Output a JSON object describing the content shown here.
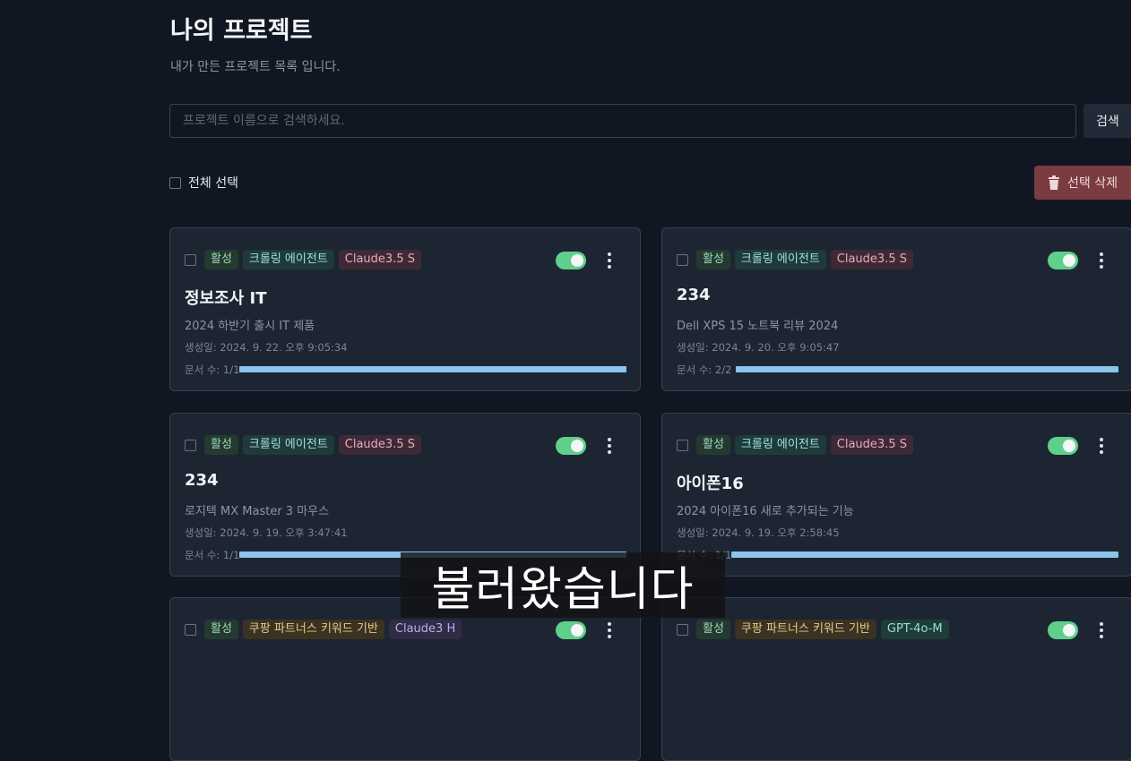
{
  "header": {
    "title": "나의 프로젝트",
    "subtitle": "내가 만든 프로젝트 목록 입니다."
  },
  "search": {
    "placeholder": "프로젝트 이름으로 검색하세요.",
    "button_label": "검색"
  },
  "toolbar": {
    "select_all_label": "전체 선택",
    "delete_label": "선택 삭제",
    "delete_icon": "trash-icon"
  },
  "colors": {
    "background": "#111722",
    "card": "#1d2532",
    "toggle_on": "#5fd08c",
    "progress": "#8bc4ec",
    "delete": "#7a3c40"
  },
  "projects": [
    {
      "status": "활성",
      "type": "크롤링 에이전트",
      "model": "Claude3.5 S",
      "title": "정보조사 IT",
      "description": "2024 하반기 출시 IT 제품",
      "created": "생성일: 2024. 9. 22. 오후 9:05:34",
      "doc_count": "문서 수: 1/1",
      "progress": 1.0,
      "enabled": true
    },
    {
      "status": "활성",
      "type": "크롤링 에이전트",
      "model": "Claude3.5 S",
      "title": "234",
      "description": "Dell XPS 15 노트북 리뷰 2024",
      "created": "생성일: 2024. 9. 20. 오후 9:05:47",
      "doc_count": "문서 수: 2/2",
      "progress": 1.0,
      "enabled": true
    },
    {
      "status": "활성",
      "type": "크롤링 에이전트",
      "model": "Claude3.5 S",
      "title": "234",
      "description": "로지텍 MX Master 3 마우스",
      "created": "생성일: 2024. 9. 19. 오후 3:47:41",
      "doc_count": "문서 수: 1/1",
      "progress": 1.0,
      "enabled": true
    },
    {
      "status": "활성",
      "type": "크롤링 에이전트",
      "model": "Claude3.5 S",
      "title": "아이폰16",
      "description": "2024 아이폰16 새로 추가되는 기능",
      "created": "생성일: 2024. 9. 19. 오후 2:58:45",
      "doc_count": "문서 수: 1/1",
      "progress": 1.0,
      "enabled": true
    },
    {
      "status": "활성",
      "type": "쿠팡 파트너스 키워드 기반",
      "model": "Claude3 H",
      "enabled": true
    },
    {
      "status": "활성",
      "type": "쿠팡 파트너스 키워드 기반",
      "model": "GPT-4o-M",
      "enabled": true
    }
  ],
  "video_caption": "불러왔습니다"
}
